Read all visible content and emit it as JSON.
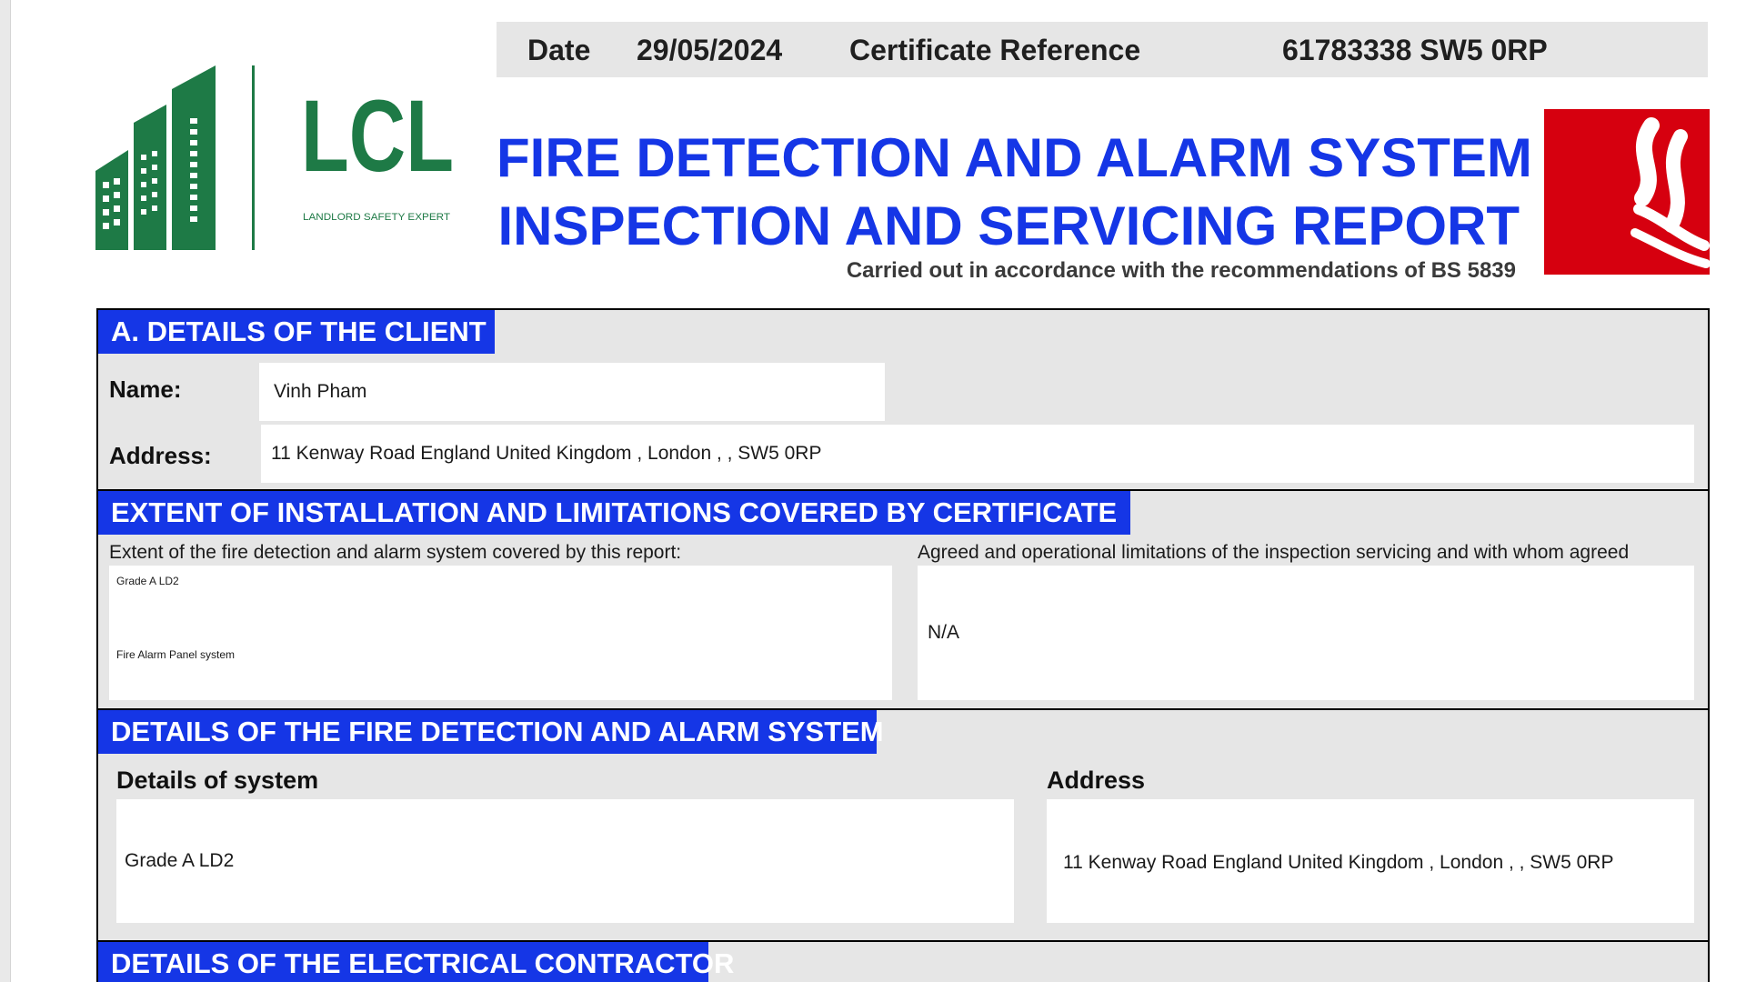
{
  "header": {
    "date_label": "Date",
    "date_value": "29/05/2024",
    "cert_ref_label": "Certificate Reference",
    "cert_ref_value": "61783338 SW5 0RP"
  },
  "logo": {
    "letters": "LCL",
    "tagline": "LANDLORD SAFETY EXPERT",
    "color": "#1e7a46"
  },
  "title": {
    "line1": "FIRE DETECTION AND ALARM SYSTEM",
    "line2": "INSPECTION AND SERVICING REPORT",
    "subtitle": "Carried out in accordance with the recommendations of BS 5839"
  },
  "colors": {
    "accent_blue": "#1536e6",
    "fire_red": "#d6000f",
    "panel_grey": "#e6e6e6"
  },
  "icons": {
    "fire_sign": "fire-sign-icon"
  },
  "client": {
    "heading": "A. DETAILS OF THE CLIENT",
    "name_label": "Name:",
    "name_value": "Vinh Pham",
    "address_label": "Address:",
    "address_value": "11 Kenway Road England United Kingdom , London , , SW5 0RP"
  },
  "extent": {
    "heading": "EXTENT OF INSTALLATION AND LIMITATIONS COVERED BY CERTIFICATE",
    "extent_label": "Extent of the fire detection and alarm system covered by this report:",
    "extent_line1": "Grade A  LD2",
    "extent_line2": "Fire Alarm Panel system",
    "limitations_label": "Agreed and operational limitations of the inspection  servicing and with whom agreed",
    "limitations_value": "N/A"
  },
  "system": {
    "heading": "DETAILS OF THE FIRE DETECTION AND ALARM SYSTEM",
    "details_label": "Details of system",
    "details_value": "Grade A LD2",
    "address_label": "Address",
    "address_value": "11 Kenway Road England United Kingdom , London , , SW5 0RP"
  },
  "contractor": {
    "heading": "DETAILS OF THE ELECTRICAL CONTRACTOR"
  }
}
